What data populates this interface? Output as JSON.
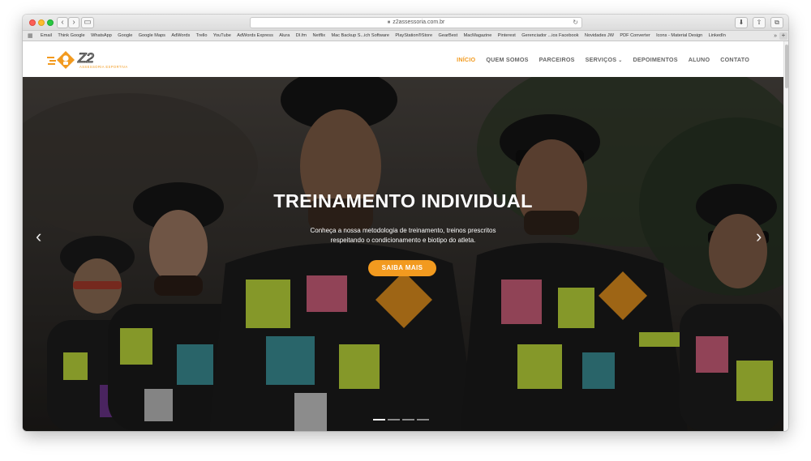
{
  "browser": {
    "url": "z2assessoria.com.br",
    "back_glyph": "‹",
    "forward_glyph": "›",
    "sidebar_glyph": "▭",
    "reload_glyph": "↻",
    "download_glyph": "⬇",
    "share_glyph": "⇧",
    "tabs_glyph": "⧉"
  },
  "bookmarks": {
    "grid_glyph": "▦",
    "more": "»",
    "plus": "+",
    "items": [
      "Email",
      "Think Google",
      "WhatsApp",
      "Google",
      "Google Maps",
      "AdWords",
      "Trello",
      "YouTube",
      "AdWords Express",
      "Alura",
      "DI.fm",
      "Netflix",
      "Mac Backup S...ich Software",
      "PlayStation®Store",
      "GearBest",
      "MacMagazine",
      "Pinterest",
      "Gerenciador ...ios Facebook",
      "Novidades JW",
      "PDF Converter",
      "Icons - Material Design",
      "LinkedIn"
    ]
  },
  "logo": {
    "brand": "Z2",
    "tagline": "ASSESSORIA ESPORTIVA"
  },
  "nav": {
    "items": [
      {
        "label": "INÍCIO"
      },
      {
        "label": "QUEM SOMOS"
      },
      {
        "label": "PARCEIROS"
      },
      {
        "label": "SERVIÇOS"
      },
      {
        "label": "DEPOIMENTOS"
      },
      {
        "label": "ALUNO"
      },
      {
        "label": "CONTATO"
      }
    ],
    "chevron": "⌄"
  },
  "hero": {
    "title": "TREINAMENTO INDIVIDUAL",
    "subtitle": "Conheça a nossa metodologia de treinamento, treinos prescritos respeitando o condicionamento e biotipo do atleta.",
    "cta": "SAIBA MAIS",
    "prev_glyph": "‹",
    "next_glyph": "›",
    "slides_total": 4,
    "active_slide": 1
  },
  "colors": {
    "accent": "#f29a1f",
    "menu_text": "#666666",
    "hero_text": "#ffffff"
  }
}
